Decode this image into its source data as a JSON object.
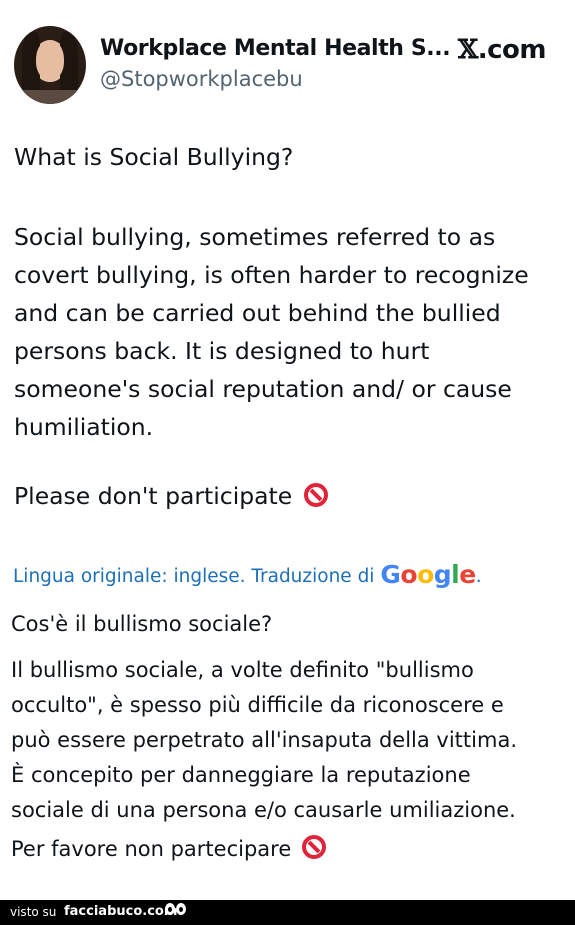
{
  "tweet": {
    "author_name": "Workplace Mental Health S...",
    "author_handle": "@Stopworkplacebu",
    "site_logo": "𝕏.com",
    "question": "What is Social Bullying?",
    "paragraph_lines": [
      "Social bullying, sometimes referred to as",
      "covert bullying, is often harder to recognize",
      "and can be carried out behind the bullied",
      "persons back. It is designed to hurt",
      "someone's social reputation and/ or cause",
      "humiliation."
    ],
    "closing": "Please don't participate",
    "closing_icon": "no-entry-icon"
  },
  "translation": {
    "notice": "Lingua originale: inglese. Traduzione di",
    "google_logo": "Google",
    "trailing": ".",
    "question": "Cos'è il bullismo sociale?",
    "paragraph_lines": [
      "Il bullismo sociale, a volte definito \"bullismo",
      "occulto\", è spesso più difficile da riconoscere e",
      "può essere perpetrato all'insaputa della vittima.",
      "È concepito per danneggiare la reputazione",
      "sociale di una persona e/o causarle umiliazione."
    ],
    "closing": "Per favore non partecipare",
    "closing_icon": "no-entry-icon"
  },
  "footer": {
    "seen_on": "visto su",
    "brand": "facciabuco.com"
  },
  "colors": {
    "link": "#1d6fb8",
    "handle": "#536471",
    "no_entry": "#e0243a"
  }
}
